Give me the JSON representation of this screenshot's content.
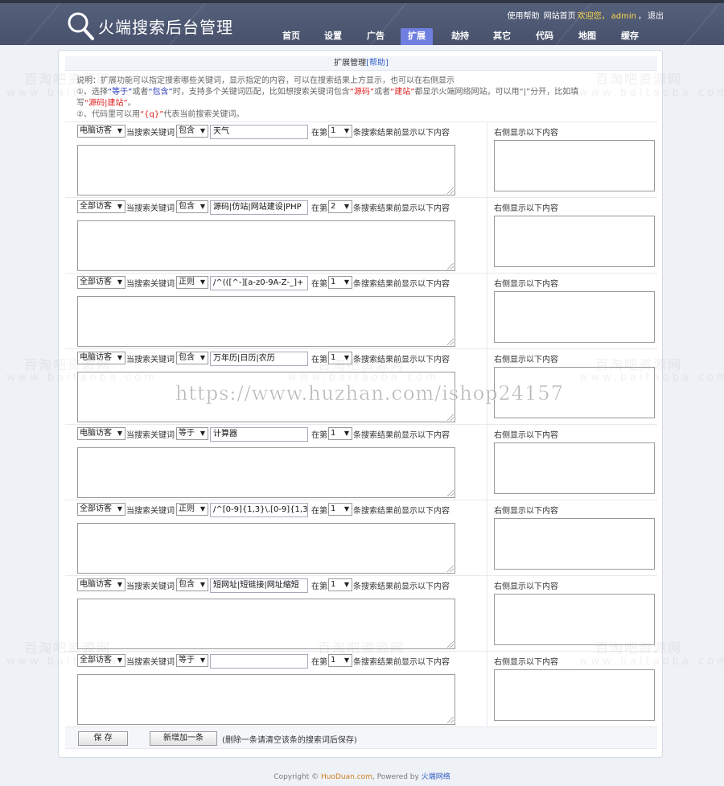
{
  "header": {
    "logo_text": "火端搜索后台管理",
    "top_links": {
      "help": "使用帮助",
      "home": "网站首页",
      "welcome": "欢迎您，",
      "user": "admin",
      "separator": "，",
      "logout": "退出"
    },
    "nav": [
      "首页",
      "设置",
      "广告",
      "扩展",
      "劫持",
      "其它",
      "代码",
      "地图",
      "缓存"
    ],
    "active_nav": "扩展"
  },
  "panel": {
    "title": "扩展管理",
    "help_link": "[帮助]",
    "desc_line1": "说明：扩展功能可以指定搜索哪些关键词，显示指定的内容，可以在搜索结果上方显示，也可以在右侧显示",
    "desc_line2_a": "①、选择",
    "desc_line2_eq": "“等于”",
    "desc_line2_or": "或者",
    "desc_line2_contains": "“包含”",
    "desc_line2_b": "时，支持多个关键词匹配，比如想搜索关键词包含",
    "desc_line2_src": "“源码”",
    "desc_line2_or2": "或者",
    "desc_line2_site": "“建站”",
    "desc_line2_c": "都显示火端网络网站，可以用“|”分开，比如填",
    "desc_line3_a": "写",
    "desc_line3_ex": "“源码|建站”",
    "desc_line3_b": "。",
    "desc_line4_a": "②、代码里可以用",
    "desc_line4_q": "“{q}”",
    "desc_line4_b": "代表当前搜索关键词。"
  },
  "labels": {
    "when_search": "当搜索关键词",
    "at_pos": "在第",
    "show_before": "条搜索结果前显示以下内容",
    "right_show": "右侧显示以下内容"
  },
  "rules": [
    {
      "visitor": "电脑访客",
      "match": "包含",
      "keyword": "天气",
      "position": "1"
    },
    {
      "visitor": "全部访客",
      "match": "包含",
      "keyword": "源码|仿站|网站建设|PHP",
      "position": "2"
    },
    {
      "visitor": "全部访客",
      "match": "正则",
      "keyword": "/^(([^-][a-z0-9A-Z-_]+",
      "position": "1"
    },
    {
      "visitor": "电脑访客",
      "match": "包含",
      "keyword": "万年历|日历|农历",
      "position": "1"
    },
    {
      "visitor": "电脑访客",
      "match": "等于",
      "keyword": "计算器",
      "position": "1"
    },
    {
      "visitor": "全部访客",
      "match": "正则",
      "keyword": "/^[0-9]{1,3}\\.[0-9]{1,3}\\",
      "position": "1"
    },
    {
      "visitor": "电脑访客",
      "match": "包含",
      "keyword": "短网址|短链接|网址缩短",
      "position": "1"
    },
    {
      "visitor": "全部访客",
      "match": "等于",
      "keyword": "",
      "position": "1"
    }
  ],
  "bottom": {
    "save": "保 存",
    "add_new": "新增加一条",
    "note": "(删除一条请清空该条的搜索词后保存)"
  },
  "footer": {
    "copyright": "Copyright ©",
    "site": "HuoDuan.com",
    "powered": ", Powered by",
    "brand": "火端网络"
  },
  "watermarks": {
    "cn": "百淘吧资源网",
    "en": "www.baitaoba.com",
    "url": "https://www.huzhan.com/ishop24157"
  },
  "colors": {
    "header_bg": "#4d576f",
    "nav_active": "#6f7fe0",
    "highlight_red": "#e02020",
    "highlight_blue": "#2a3ab8",
    "welcome_yellow": "#ffd84a"
  }
}
